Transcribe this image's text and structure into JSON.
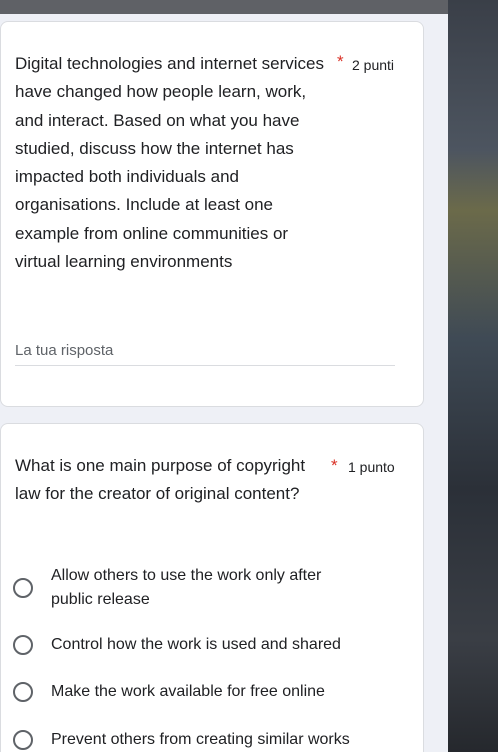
{
  "questions": [
    {
      "title": "Digital technologies and internet services have changed how people learn, work, and interact. Based on what you have studied, discuss how the internet has impacted both individuals and organisations. Include at least one example from online communities or virtual learning environments",
      "required_mark": "*",
      "points": "2 punti",
      "answer_placeholder": "La tua risposta"
    },
    {
      "title": "What is one main purpose of copyright law for the creator of original content?",
      "required_mark": "*",
      "points": "1 punto",
      "options": [
        "Allow others to use the work only after public release",
        "Control how the work is used and shared",
        "Make the work available for free online",
        "Prevent others from creating similar works"
      ]
    }
  ],
  "colors": {
    "required": "#d93025",
    "background": "#eef0f6",
    "card": "#ffffff"
  }
}
